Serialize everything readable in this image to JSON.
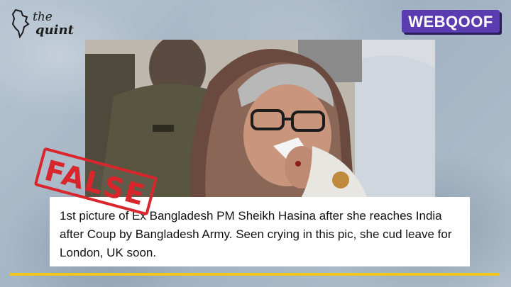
{
  "logo": {
    "line1": "the",
    "line2": "quint"
  },
  "badge": {
    "label": "WEBQOOF"
  },
  "stamp": {
    "label": "FALSE"
  },
  "tweet": {
    "text": "1st picture of Ex Bangladesh PM Sheikh Hasina after she reaches India after Coup by Bangladesh Army. Seen crying in this pic, she cud leave for London, UK soon."
  },
  "colors": {
    "badge": "#5a3bb0",
    "stamp": "#d8262c",
    "accent_line": "#f3c61d"
  }
}
